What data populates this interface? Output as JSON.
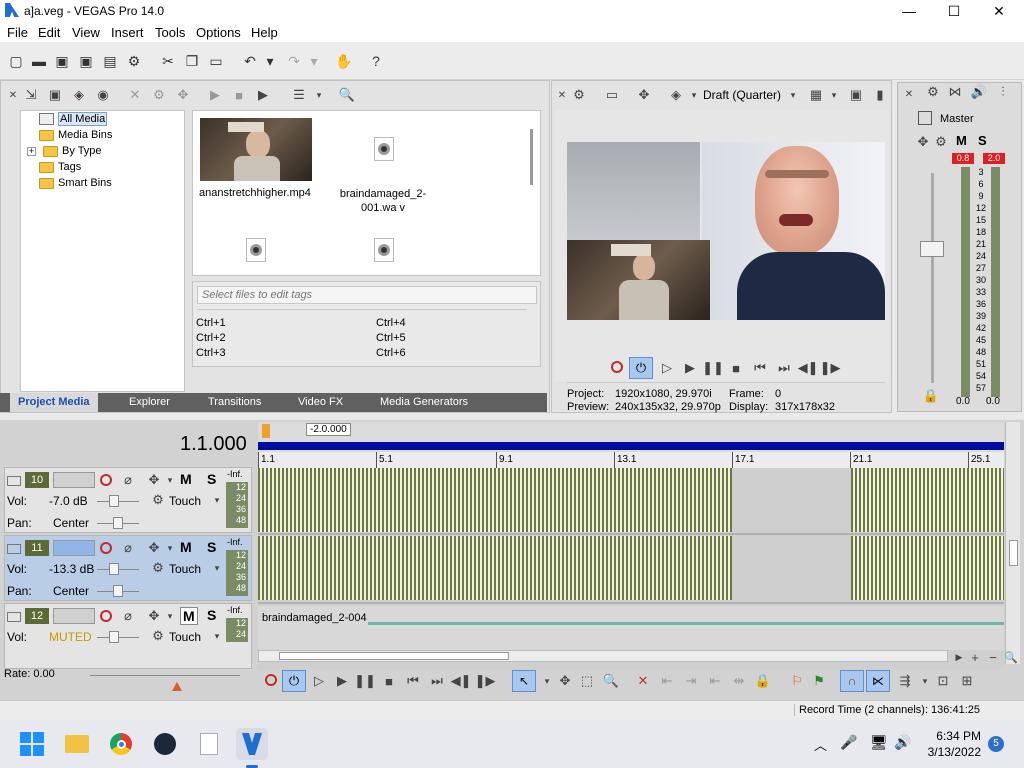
{
  "window": {
    "title": "a]a.veg - VEGAS Pro 14.0",
    "minimize": "—",
    "maximize": "☐",
    "close": "✕"
  },
  "menu": [
    "File",
    "Edit",
    "View",
    "Insert",
    "Tools",
    "Options",
    "Help"
  ],
  "project_media": {
    "tree": [
      {
        "label": "All Media",
        "selected": true
      },
      {
        "label": "Media Bins"
      },
      {
        "label": "By Type",
        "expand": "+"
      },
      {
        "label": "Tags"
      },
      {
        "label": "Smart Bins"
      }
    ],
    "items": [
      {
        "name": "ananstretchhigher.mp4",
        "kind": "video"
      },
      {
        "name": "braindamaged_2-001.wa v",
        "kind": "audio"
      },
      {
        "name": "",
        "kind": "audio"
      },
      {
        "name": "",
        "kind": "audio"
      }
    ],
    "tags_placeholder": "Select files to edit tags",
    "shortcuts": [
      "Ctrl+1",
      "Ctrl+2",
      "Ctrl+3",
      "Ctrl+4",
      "Ctrl+5",
      "Ctrl+6"
    ]
  },
  "tabs": [
    "Project Media",
    "Explorer",
    "Transitions",
    "Video FX",
    "Media Generators"
  ],
  "preview": {
    "quality": "Draft (Quarter)",
    "project_label": "Project:",
    "project_value": "1920x1080, 29.970i",
    "preview_label": "Preview:",
    "preview_value": "240x135x32, 29.970p",
    "frame_label": "Frame:",
    "frame_value": "0",
    "display_label": "Display:",
    "display_value": "317x178x32"
  },
  "master": {
    "label": "Master",
    "m": "M",
    "s": "S",
    "peak_left": "0.8",
    "peak_right": "2.0",
    "scale": [
      "3",
      "6",
      "9",
      "12",
      "15",
      "18",
      "21",
      "24",
      "27",
      "30",
      "33",
      "36",
      "39",
      "42",
      "45",
      "48",
      "51",
      "54",
      "57"
    ],
    "bottom_left": "0.0",
    "bottom_right": "0.0"
  },
  "timeline": {
    "time": "1.1.000",
    "marker": "-2.0.000",
    "ruler": [
      "1.1",
      "5.1",
      "9.1",
      "13.1",
      "17.1",
      "21.1",
      "25.1"
    ],
    "rate": "Rate: 0.00",
    "tracks": [
      {
        "num": "10",
        "vol_label": "Vol:",
        "vol": "-7.0 dB",
        "pan_label": "Pan:",
        "pan": "Center",
        "auto": "Touch",
        "m": "M",
        "s": "S",
        "inf": "-Inf.",
        "meter": [
          "12",
          "24",
          "36",
          "48"
        ],
        "selected": false
      },
      {
        "num": "11",
        "vol_label": "Vol:",
        "vol": "-13.3 dB",
        "pan_label": "Pan:",
        "pan": "Center",
        "auto": "Touch",
        "m": "M",
        "s": "S",
        "inf": "-Inf.",
        "meter": [
          "12",
          "24",
          "36",
          "48"
        ],
        "selected": true
      },
      {
        "num": "12",
        "vol_label": "Vol:",
        "vol": "MUTED",
        "pan_label": "",
        "pan": "",
        "auto": "Touch",
        "m": "M",
        "s": "S",
        "inf": "-Inf.",
        "meter": [
          "12",
          "24"
        ],
        "selected": false
      }
    ],
    "clip3_name": "braindamaged_2-004"
  },
  "status": {
    "record_time": "Record Time (2 channels): 136:41:25"
  },
  "taskbar": {
    "time": "6:34 PM",
    "date": "3/13/2022",
    "badge": "5"
  }
}
